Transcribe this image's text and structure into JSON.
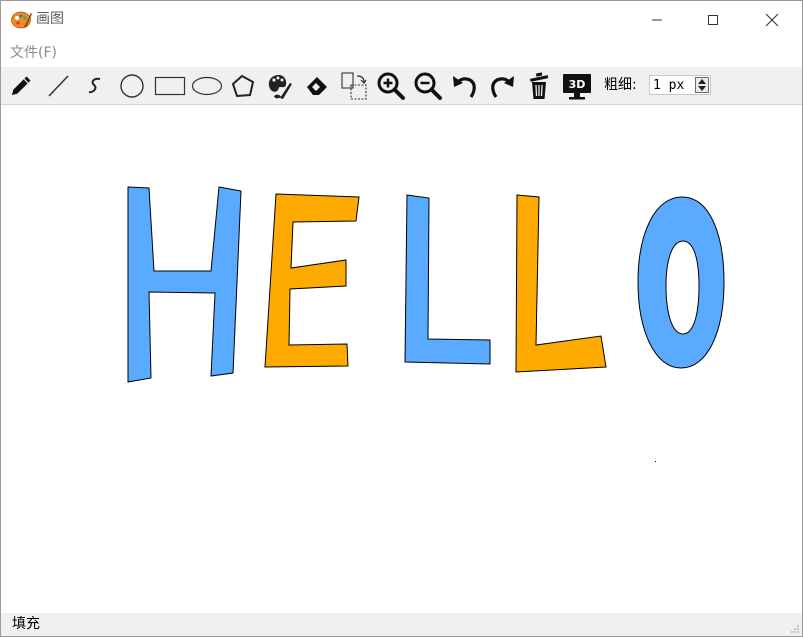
{
  "window": {
    "title": "画图",
    "app_icon": "paint-palette-icon"
  },
  "menu": {
    "file_label": "文件(F)"
  },
  "toolbar": {
    "tools": [
      {
        "name": "pencil-tool",
        "icon": "pencil-icon"
      },
      {
        "name": "line-tool",
        "icon": "line-icon"
      },
      {
        "name": "curve-tool",
        "icon": "curve-icon"
      },
      {
        "name": "circle-tool",
        "icon": "circle-icon"
      },
      {
        "name": "rectangle-tool",
        "icon": "rectangle-icon"
      },
      {
        "name": "ellipse-tool",
        "icon": "ellipse-icon"
      },
      {
        "name": "polygon-tool",
        "icon": "polygon-icon"
      },
      {
        "name": "color-palette-tool",
        "icon": "palette-icon"
      },
      {
        "name": "eraser-tool",
        "icon": "eraser-icon"
      },
      {
        "name": "select-copy-tool",
        "icon": "select-copy-icon"
      },
      {
        "name": "zoom-in-tool",
        "icon": "zoom-in-icon"
      },
      {
        "name": "zoom-out-tool",
        "icon": "zoom-out-icon"
      },
      {
        "name": "undo-tool",
        "icon": "undo-icon"
      },
      {
        "name": "redo-tool",
        "icon": "redo-icon"
      },
      {
        "name": "clear-tool",
        "icon": "trash-icon"
      },
      {
        "name": "3d-tool",
        "icon": "3d-monitor-icon",
        "icon_text": "3D"
      }
    ],
    "thickness_label": "粗细:",
    "thickness_value": "1 px"
  },
  "canvas": {
    "letters": [
      {
        "char": "H",
        "fill": "#5aabff"
      },
      {
        "char": "E",
        "fill": "#ffaa00"
      },
      {
        "char": "L",
        "fill": "#5aabff"
      },
      {
        "char": "L",
        "fill": "#ffaa00"
      },
      {
        "char": "O",
        "fill": "#5aabff"
      }
    ],
    "stroke_color": "#000000"
  },
  "status": {
    "text": "填充"
  },
  "colors": {
    "blue_fill": "#5aabff",
    "orange_fill": "#ffaa00",
    "toolbar_bg": "#f0f0f0",
    "menu_text": "#8a8a8a"
  }
}
